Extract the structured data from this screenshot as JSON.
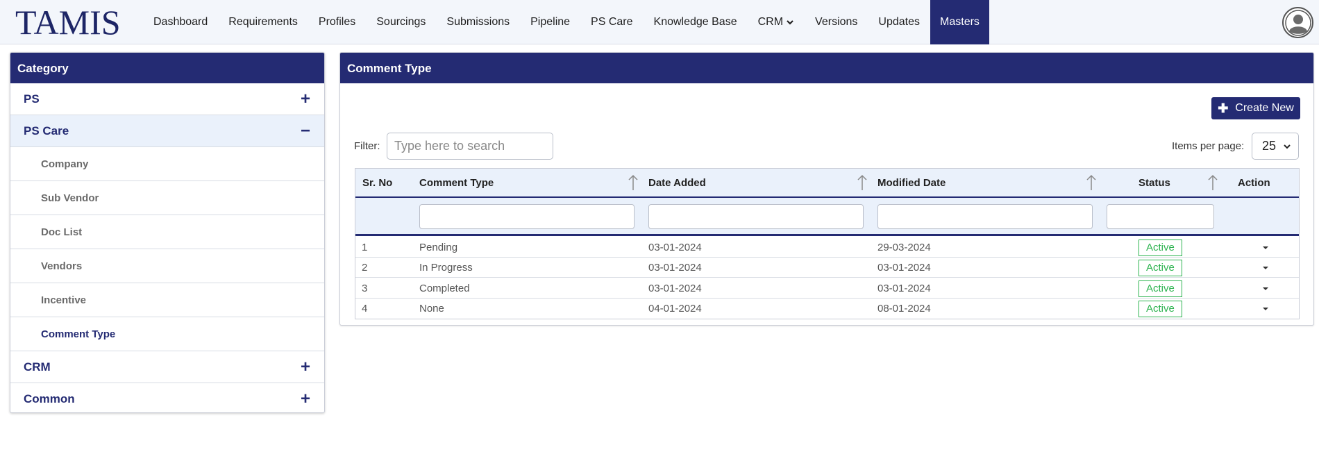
{
  "app": {
    "logo": "TAMIS"
  },
  "nav": {
    "items": [
      "Dashboard",
      "Requirements",
      "Profiles",
      "Sourcings",
      "Submissions",
      "Pipeline",
      "PS Care",
      "Knowledge Base",
      "CRM",
      "Versions",
      "Updates",
      "Masters"
    ],
    "active": "Masters"
  },
  "sidebar": {
    "title": "Category",
    "categories": [
      {
        "label": "PS",
        "symbol": "+"
      },
      {
        "label": "PS Care",
        "symbol": "−",
        "open": true
      },
      {
        "label": "CRM",
        "symbol": "+"
      },
      {
        "label": "Common",
        "symbol": "+"
      }
    ],
    "sub_items": [
      "Company",
      "Sub Vendor",
      "Doc List",
      "Vendors",
      "Incentive",
      "Comment Type"
    ],
    "active_sub": "Comment Type"
  },
  "main": {
    "title": "Comment Type",
    "create_label": "Create New",
    "filter_label": "Filter:",
    "filter_placeholder": "Type here to search",
    "ipp_label": "Items per page:",
    "ipp_value": "25"
  },
  "table": {
    "headers": [
      "Sr. No",
      "Comment Type",
      "Date Added",
      "Modified Date",
      "Status",
      "Action"
    ],
    "rows": [
      {
        "sr": "1",
        "type": "Pending",
        "added": "03-01-2024",
        "modified": "29-03-2024",
        "status": "Active"
      },
      {
        "sr": "2",
        "type": "In Progress",
        "added": "03-01-2024",
        "modified": "03-01-2024",
        "status": "Active"
      },
      {
        "sr": "3",
        "type": "Completed",
        "added": "03-01-2024",
        "modified": "03-01-2024",
        "status": "Active"
      },
      {
        "sr": "4",
        "type": "None",
        "added": "04-01-2024",
        "modified": "08-01-2024",
        "status": "Active"
      }
    ]
  },
  "colors": {
    "brand": "#242b73",
    "active_status": "#2cb34f",
    "header_bg": "#eaf1fb"
  }
}
